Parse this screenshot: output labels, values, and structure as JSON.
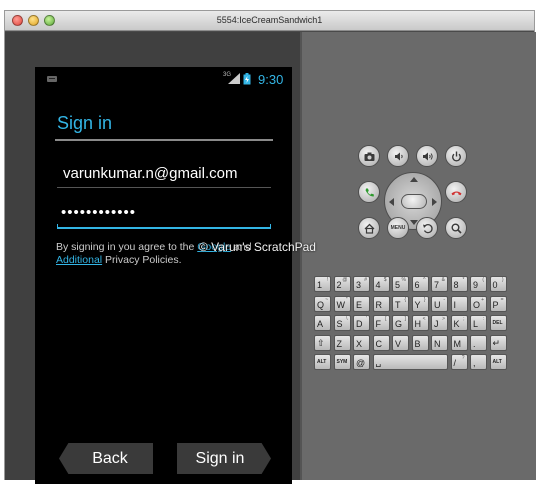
{
  "window": {
    "title": "5554:IceCreamSandwich1"
  },
  "statusbar": {
    "network": "3G",
    "time": "9:30"
  },
  "screen": {
    "title": "Sign in",
    "email_value": "varunkumar.n@gmail.com",
    "password_value": "••••••••••••",
    "terms": {
      "prefix": "By signing in you agree to the ",
      "link1": "Google",
      "middle": " and",
      "link2": "Additional",
      "suffix": " Privacy Policies."
    },
    "back_label": "Back",
    "signin_label": "Sign in"
  },
  "watermark": "© Varun's ScratchPad",
  "hardware": {
    "menu_label": "MENU",
    "colors": {
      "call": "#2e9a2e",
      "end_call": "#d03030"
    }
  },
  "keyboard": {
    "rows": [
      [
        {
          "main": "1",
          "alt": "!"
        },
        {
          "main": "2",
          "alt": "@"
        },
        {
          "main": "3",
          "alt": "#"
        },
        {
          "main": "4",
          "alt": "$"
        },
        {
          "main": "5",
          "alt": "%"
        },
        {
          "main": "6",
          "alt": "^"
        },
        {
          "main": "7",
          "alt": "&"
        },
        {
          "main": "8",
          "alt": "*"
        },
        {
          "main": "9",
          "alt": "("
        },
        {
          "main": "0",
          "alt": ")"
        }
      ],
      [
        {
          "main": "Q",
          "alt": "~"
        },
        {
          "main": "W",
          "alt": "\""
        },
        {
          "main": "E",
          "alt": ""
        },
        {
          "main": "R",
          "alt": ""
        },
        {
          "main": "T",
          "alt": "{"
        },
        {
          "main": "Y",
          "alt": "}"
        },
        {
          "main": "U",
          "alt": "-"
        },
        {
          "main": "I",
          "alt": ""
        },
        {
          "main": "O",
          "alt": "+"
        },
        {
          "main": "P",
          "alt": "="
        }
      ],
      [
        {
          "main": "A",
          "alt": ""
        },
        {
          "main": "S",
          "alt": "\\"
        },
        {
          "main": "D",
          "alt": "'"
        },
        {
          "main": "F",
          "alt": "["
        },
        {
          "main": "G",
          "alt": "]"
        },
        {
          "main": "H",
          "alt": "<"
        },
        {
          "main": "J",
          "alt": ">"
        },
        {
          "main": "K",
          "alt": ";"
        },
        {
          "main": "L",
          "alt": ":"
        },
        {
          "main": "DEL",
          "alt": ""
        }
      ],
      [
        {
          "main": "⇧",
          "alt": ""
        },
        {
          "main": "Z",
          "alt": ""
        },
        {
          "main": "X",
          "alt": ""
        },
        {
          "main": "C",
          "alt": ""
        },
        {
          "main": "V",
          "alt": ""
        },
        {
          "main": "B",
          "alt": ""
        },
        {
          "main": "N",
          "alt": ""
        },
        {
          "main": "M",
          "alt": ""
        },
        {
          "main": ".",
          "alt": ""
        },
        {
          "main": "↵",
          "alt": ""
        }
      ],
      [
        {
          "main": "ALT",
          "alt": ""
        },
        {
          "main": "SYM",
          "alt": ""
        },
        {
          "main": "@",
          "alt": ""
        },
        {
          "main": "␣",
          "alt": ""
        },
        {
          "main": "/",
          "alt": "?"
        },
        {
          "main": ",",
          "alt": ""
        },
        {
          "main": "ALT",
          "alt": ""
        }
      ]
    ]
  }
}
